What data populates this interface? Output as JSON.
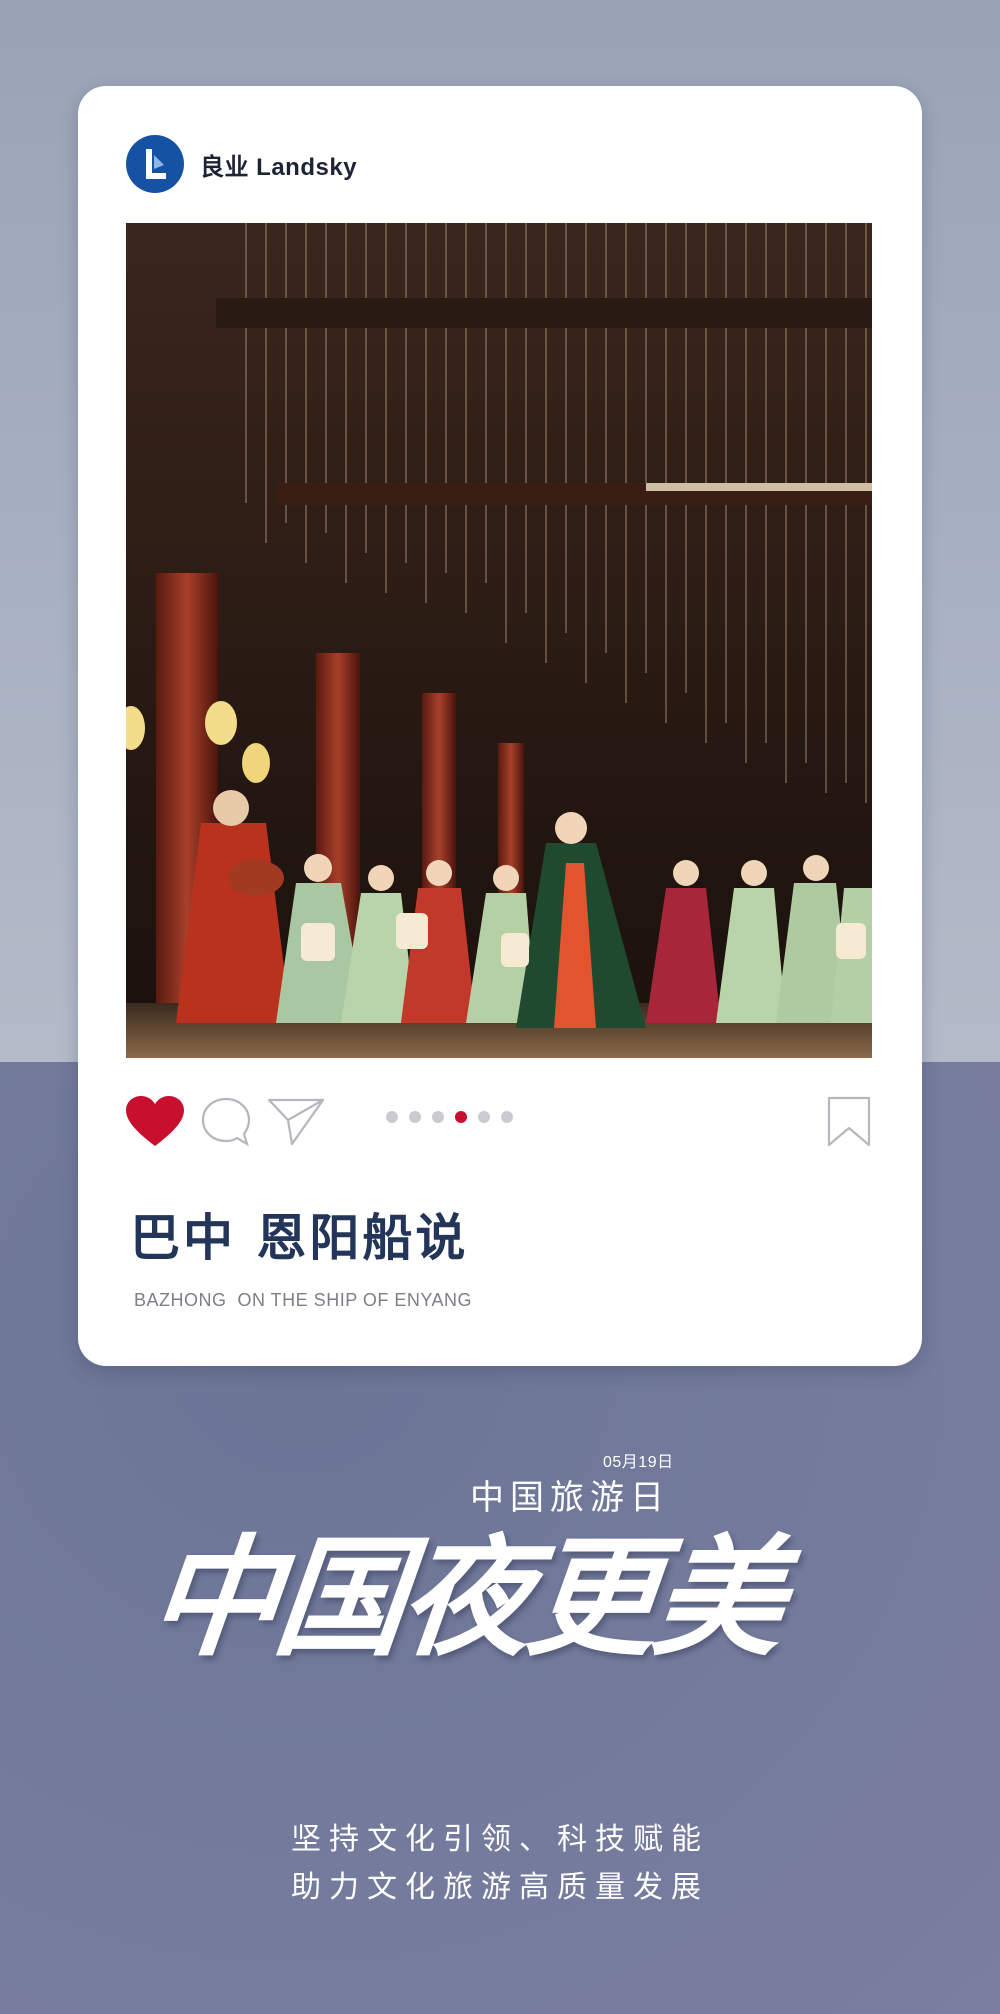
{
  "brand": {
    "name": "良业 Landsky",
    "logo_icon": "landsky-logo-icon"
  },
  "post": {
    "photo_icon": "stage-performance-photo",
    "carousel": {
      "count": 6,
      "active_index": 3
    },
    "actions": {
      "liked": true,
      "like_color": "#c8102e"
    },
    "title_cn": "巴中 恩阳船说",
    "title_en": "BAZHONG  ON THE SHIP OF ENYANG"
  },
  "event": {
    "date": "05月19日",
    "name": "中国旅游日",
    "slogan": "中国夜更美"
  },
  "tagline": {
    "line1": "坚持文化引领、科技赋能",
    "line2": "助力文化旅游高质量发展"
  },
  "colors": {
    "title": "#233659",
    "accent": "#c8102e",
    "brand_blue": "#1652a3"
  }
}
